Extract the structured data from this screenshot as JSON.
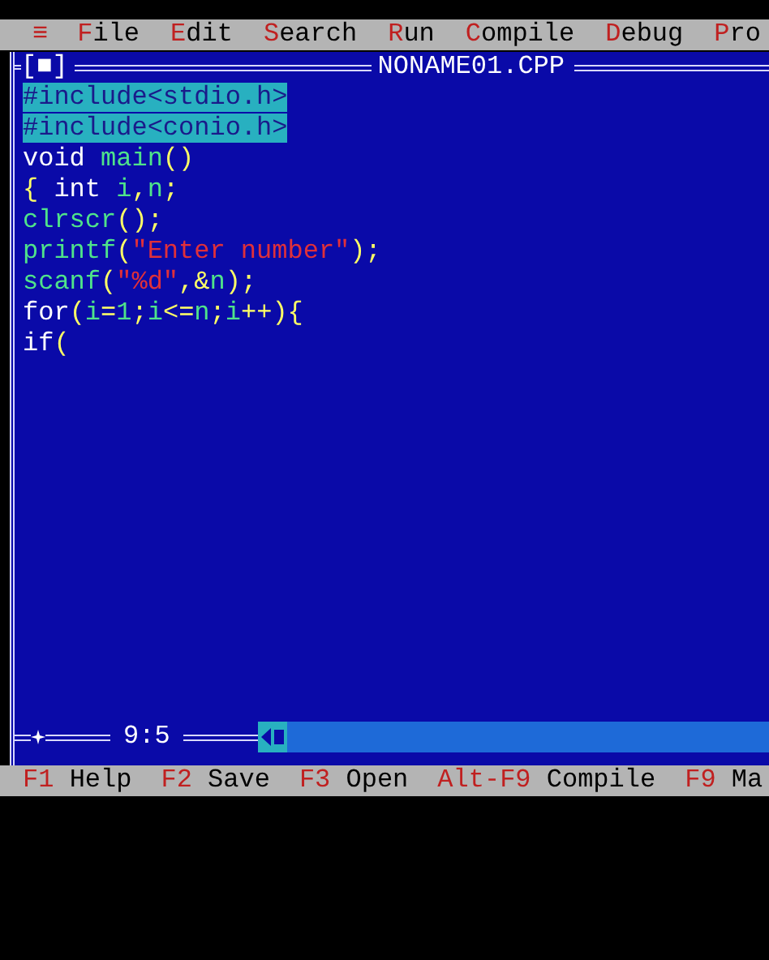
{
  "menu_bar": {
    "system_icon": "≡",
    "items": [
      {
        "hotkey": "F",
        "rest": "ile"
      },
      {
        "hotkey": "E",
        "rest": "dit"
      },
      {
        "hotkey": "S",
        "rest": "earch"
      },
      {
        "hotkey": "R",
        "rest": "un"
      },
      {
        "hotkey": "C",
        "rest": "ompile"
      },
      {
        "hotkey": "D",
        "rest": "ebug"
      },
      {
        "hotkey": "P",
        "rest": "ro"
      }
    ]
  },
  "editor": {
    "close_box": "[■]",
    "filename": "NONAME01.CPP",
    "cursor_position": "9:5",
    "lines": [
      {
        "selected": true,
        "tokens": [
          {
            "kind": "preprocessor",
            "text": "#include<stdio.h>"
          }
        ]
      },
      {
        "selected": true,
        "tokens": [
          {
            "kind": "preprocessor",
            "text": "#include<conio.h>"
          }
        ]
      },
      {
        "selected": false,
        "tokens": [
          {
            "kind": "keyword",
            "text": "void "
          },
          {
            "kind": "ident",
            "text": "main"
          },
          {
            "kind": "symbol",
            "text": "()"
          }
        ]
      },
      {
        "selected": false,
        "tokens": [
          {
            "kind": "symbol",
            "text": "{ "
          },
          {
            "kind": "keyword",
            "text": "int "
          },
          {
            "kind": "ident",
            "text": "i"
          },
          {
            "kind": "symbol",
            "text": ","
          },
          {
            "kind": "ident",
            "text": "n"
          },
          {
            "kind": "symbol",
            "text": ";"
          }
        ]
      },
      {
        "selected": false,
        "tokens": [
          {
            "kind": "ident",
            "text": "clrscr"
          },
          {
            "kind": "symbol",
            "text": "();"
          }
        ]
      },
      {
        "selected": false,
        "tokens": [
          {
            "kind": "ident",
            "text": "printf"
          },
          {
            "kind": "symbol",
            "text": "("
          },
          {
            "kind": "string",
            "text": "\"Enter number\""
          },
          {
            "kind": "symbol",
            "text": ");"
          }
        ]
      },
      {
        "selected": false,
        "tokens": [
          {
            "kind": "ident",
            "text": "scanf"
          },
          {
            "kind": "symbol",
            "text": "("
          },
          {
            "kind": "string",
            "text": "\"%d\""
          },
          {
            "kind": "symbol",
            "text": ",&"
          },
          {
            "kind": "ident",
            "text": "n"
          },
          {
            "kind": "symbol",
            "text": ");"
          }
        ]
      },
      {
        "selected": false,
        "tokens": [
          {
            "kind": "keyword",
            "text": "for"
          },
          {
            "kind": "symbol",
            "text": "("
          },
          {
            "kind": "ident",
            "text": "i"
          },
          {
            "kind": "symbol",
            "text": "="
          },
          {
            "kind": "number",
            "text": "1"
          },
          {
            "kind": "symbol",
            "text": ";"
          },
          {
            "kind": "ident",
            "text": "i"
          },
          {
            "kind": "symbol",
            "text": "<="
          },
          {
            "kind": "ident",
            "text": "n"
          },
          {
            "kind": "symbol",
            "text": ";"
          },
          {
            "kind": "ident",
            "text": "i"
          },
          {
            "kind": "symbol",
            "text": "++){"
          }
        ]
      },
      {
        "selected": false,
        "tokens": [
          {
            "kind": "keyword",
            "text": "if"
          },
          {
            "kind": "symbol",
            "text": "("
          }
        ]
      }
    ]
  },
  "status_bar": [
    {
      "key": "F1",
      "label": "Help"
    },
    {
      "key": "F2",
      "label": "Save"
    },
    {
      "key": "F3",
      "label": "Open"
    },
    {
      "key": "Alt-F9",
      "label": "Compile"
    },
    {
      "key": "F9",
      "label": "Ma"
    }
  ]
}
